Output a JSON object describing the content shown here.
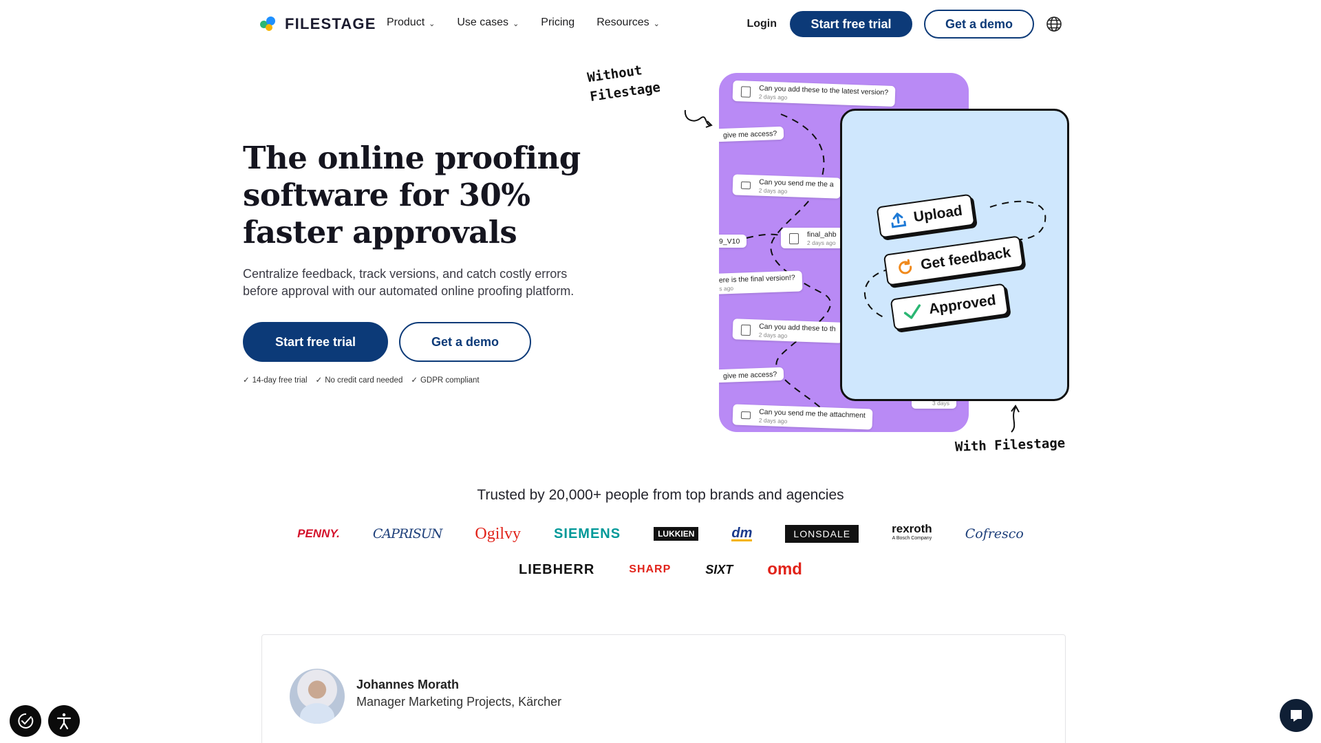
{
  "nav": {
    "logo_text": "FILESTAGE",
    "items": [
      {
        "label": "Product",
        "has_dropdown": true
      },
      {
        "label": "Use cases",
        "has_dropdown": true
      },
      {
        "label": "Pricing",
        "has_dropdown": false
      },
      {
        "label": "Resources",
        "has_dropdown": true
      }
    ],
    "login": "Login",
    "trial": "Start free trial",
    "demo": "Get a demo",
    "language_icon": "globe-icon"
  },
  "hero": {
    "title": "The online proofing software for 30% faster approvals",
    "subtitle": "Centralize feedback, track versions, and catch costly errors before approval with our automated online proofing platform.",
    "cta_primary": "Start free trial",
    "cta_secondary": "Get a demo",
    "checks": [
      "14-day free trial",
      "No credit card needed",
      "GDPR compliant"
    ]
  },
  "illustration": {
    "label_without": "Without Filestage",
    "label_with": "With Filestage",
    "messages": [
      {
        "text": "Can you add these to the latest version?",
        "time": "2 days ago",
        "icon": "file"
      },
      {
        "text": "give me access?",
        "time": "",
        "icon": "none"
      },
      {
        "text": "Can you send me the a",
        "time": "2 days ago",
        "icon": "mail"
      },
      {
        "text": "final_ahb",
        "time": "2 days ago",
        "icon": "file"
      },
      {
        "text": "9_V10",
        "time": "",
        "icon": "none"
      },
      {
        "text": "ere is the final version!?",
        "time": "s ago",
        "icon": "none"
      },
      {
        "text": "Can you add these to th",
        "time": "2 days ago",
        "icon": "file"
      },
      {
        "text": "give me access?",
        "time": "",
        "icon": "none"
      },
      {
        "text": "Can you send me the attachment",
        "time": "2 days ago",
        "icon": "mail"
      }
    ],
    "steps": [
      "Upload",
      "Get feedback",
      "Approved"
    ],
    "peek_time": "3 days"
  },
  "trusted": {
    "heading": "Trusted by 20,000+ people from top brands and agencies",
    "logos_row1": [
      {
        "name": "PENNY.",
        "color": "#d4112b"
      },
      {
        "name": "CAPRISUN",
        "color": "#1d3f7a"
      },
      {
        "name": "Ogilvy",
        "color": "#e1231a"
      },
      {
        "name": "SIEMENS",
        "color": "#009999"
      },
      {
        "name": "LUKKIEN",
        "color": "#111111"
      },
      {
        "name": "dm",
        "color": "#1a3a8c"
      },
      {
        "name": "LONSDALE",
        "color": "#ffffff"
      },
      {
        "name": "rexroth",
        "color": "#111111"
      },
      {
        "name": "A Bosch Company",
        "color": "#111111"
      },
      {
        "name": "Cofresco",
        "color": "#1d3f7a"
      }
    ],
    "logos_row2": [
      {
        "name": "LIEBHERR",
        "color": "#111111"
      },
      {
        "name": "SHARP",
        "color": "#e1231a"
      },
      {
        "name": "SIXT",
        "color": "#111111"
      },
      {
        "name": "omd",
        "color": "#e1231a"
      }
    ]
  },
  "testimonial": {
    "name": "Johannes Morath",
    "role": "Manager Marketing Projects, Kärcher"
  },
  "widgets": {
    "cookie_icon": "cookie-consent-icon",
    "accessibility_icon": "accessibility-icon",
    "chat_icon": "chat-icon"
  }
}
